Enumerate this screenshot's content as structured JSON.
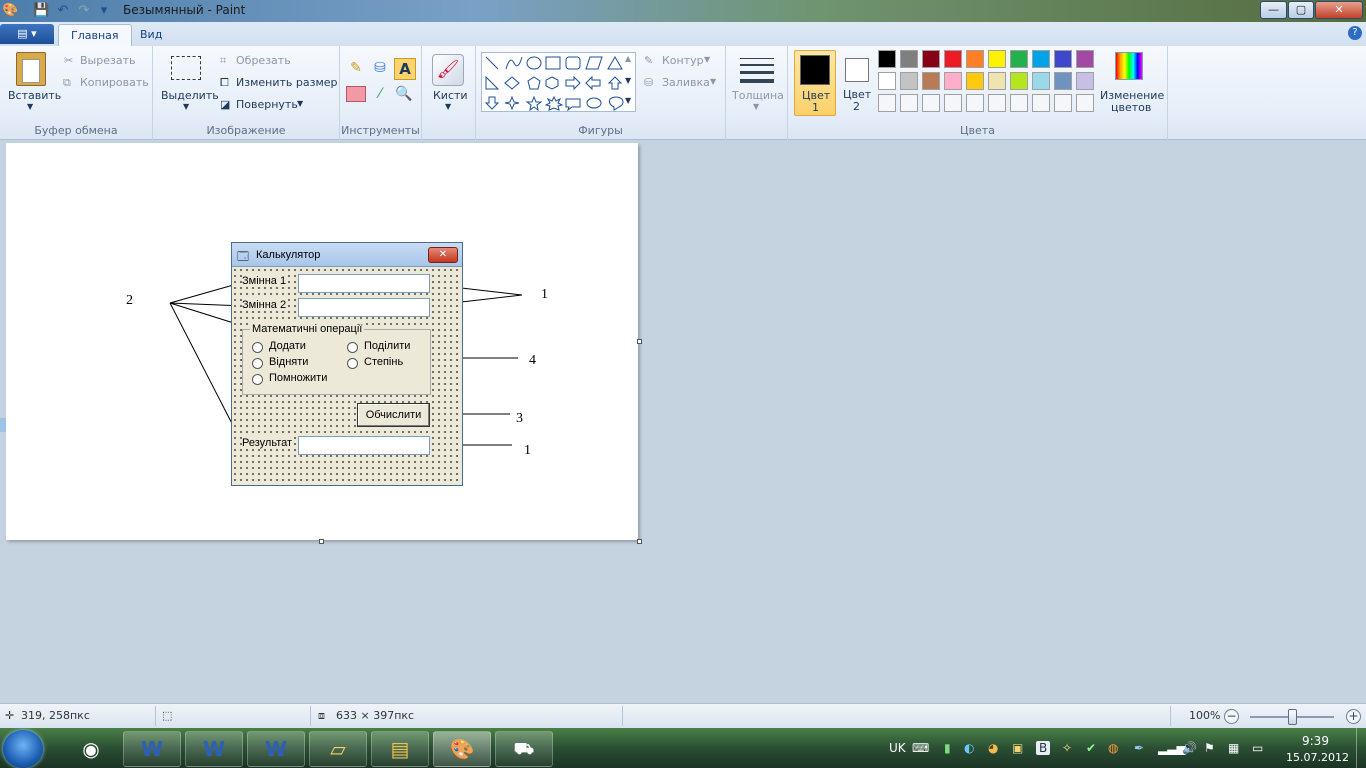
{
  "window": {
    "title": "Безымянный - Paint",
    "minimize": "—",
    "maximize": "▢",
    "close": "✕"
  },
  "tabs": {
    "app_menu": "▤ ▾",
    "home": "Главная",
    "view": "Вид",
    "help": "?"
  },
  "clipboard": {
    "paste": "Вставить",
    "cut": "Вырезать",
    "copy": "Копировать",
    "label": "Буфер обмена"
  },
  "image": {
    "select": "Выделить",
    "crop": "Обрезать",
    "resize": "Изменить размер",
    "rotate": "Повернуть",
    "label": "Изображение"
  },
  "tools": {
    "label": "Инструменты",
    "brushes": "Кисти"
  },
  "shapes": {
    "label": "Фигуры",
    "outline": "Контур",
    "fill": "Заливка"
  },
  "size": {
    "label": "Толщина"
  },
  "colors": {
    "color1": "Цвет",
    "color1_num": "1",
    "color2": "Цвет",
    "color2_num": "2",
    "label": "Цвета",
    "edit1": "Изменение",
    "edit2": "цветов",
    "row1": [
      "#000000",
      "#7f7f7f",
      "#880015",
      "#ed1c24",
      "#ff7f27",
      "#fff200",
      "#22b14c",
      "#00a2e8",
      "#3f48cc",
      "#a349a4"
    ],
    "row2": [
      "#ffffff",
      "#c3c3c3",
      "#b97a57",
      "#ffaec9",
      "#ffc90e",
      "#efe4b0",
      "#b5e61d",
      "#99d9ea",
      "#7092be",
      "#c8bfe7"
    ]
  },
  "dialog": {
    "title": "Калькулятор",
    "close": "✕",
    "var1": "Змінна 1",
    "var2": "Змінна 2",
    "group": "Математичні операції",
    "op_add": "Додати",
    "op_sub": "Відняти",
    "op_mul": "Помножити",
    "op_div": "Поділити",
    "op_pow": "Степінь",
    "calc": "Обчислити",
    "result": "Результат"
  },
  "annotations": {
    "a1": "1",
    "a2": "2",
    "a3": "3",
    "a4": "4",
    "a1b": "1"
  },
  "status": {
    "cursor": "319, 258пкс",
    "size": "633 × 397пкс",
    "zoom": "100%"
  },
  "taskbar": {
    "lang": "UK",
    "time": "9:39",
    "date": "15.07.2012"
  }
}
